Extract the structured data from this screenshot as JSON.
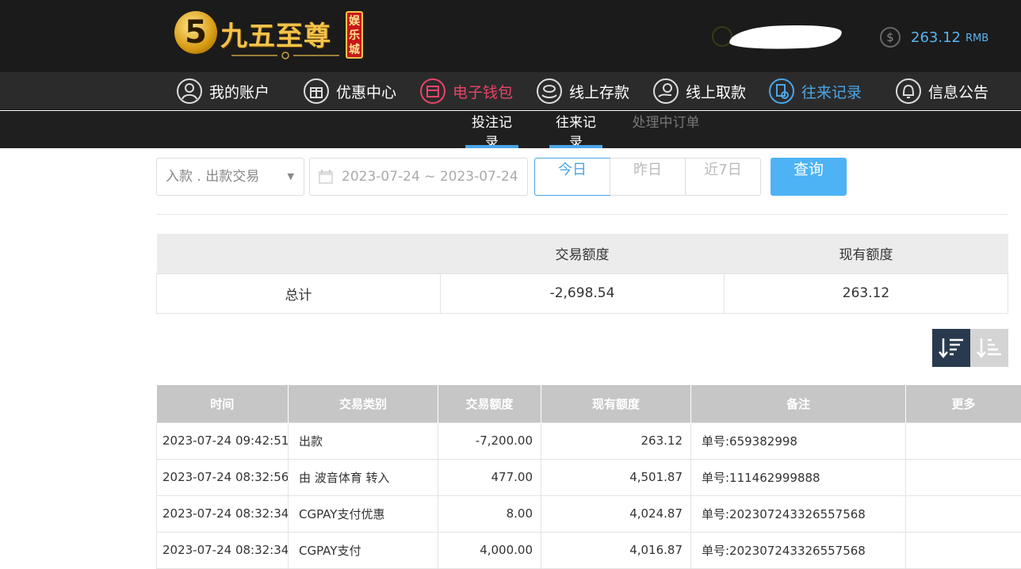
{
  "header": {
    "logo_digit": "5",
    "logo_name": "九五至尊",
    "logo_badge": "娱乐城",
    "balance": "263.12",
    "currency": "RMB"
  },
  "main_nav": [
    {
      "label": "我的账户",
      "icon": "user-icon"
    },
    {
      "label": "优惠中心",
      "icon": "gift-icon"
    },
    {
      "label": "电子钱包",
      "icon": "wallet-icon"
    },
    {
      "label": "线上存款",
      "icon": "deposit-icon"
    },
    {
      "label": "线上取款",
      "icon": "withdraw-icon"
    },
    {
      "label": "往来记录",
      "icon": "records-icon"
    },
    {
      "label": "信息公告",
      "icon": "bell-icon"
    }
  ],
  "sub_nav": [
    {
      "label": "投注记录"
    },
    {
      "label": "往来记录"
    },
    {
      "label": "处理中订单"
    }
  ],
  "filter": {
    "type_select": "入款 . 出款交易",
    "date_range": "2023-07-24 ~ 2023-07-24",
    "quick": [
      "今日",
      "昨日",
      "近7日"
    ],
    "query_label": "查询"
  },
  "summary": {
    "headers": [
      "",
      "交易额度",
      "现有额度"
    ],
    "row": [
      "总计",
      "-2,698.54",
      "263.12"
    ]
  },
  "records": {
    "headers": [
      "时间",
      "交易类别",
      "交易额度",
      "现有额度",
      "备注",
      "更多"
    ],
    "rows": [
      [
        "2023-07-24 09:42:51",
        "出款",
        "-7,200.00",
        "263.12",
        "单号:659382998",
        ""
      ],
      [
        "2023-07-24 08:32:56",
        "由 波音体育 转入",
        "477.00",
        "4,501.87",
        "单号:111462999888",
        ""
      ],
      [
        "2023-07-24 08:32:34",
        "CGPAY支付优惠",
        "8.00",
        "4,024.87",
        "单号:202307243326557568",
        ""
      ],
      [
        "2023-07-24 08:32:34",
        "CGPAY支付",
        "4,000.00",
        "4,016.87",
        "单号:202307243326557568",
        ""
      ]
    ]
  },
  "colors": {
    "accent_blue": "#4aa6e8",
    "wallet_red": "#e8456a",
    "header_bg": "#1b1b1b",
    "nav_bg": "#2b2b2b"
  }
}
